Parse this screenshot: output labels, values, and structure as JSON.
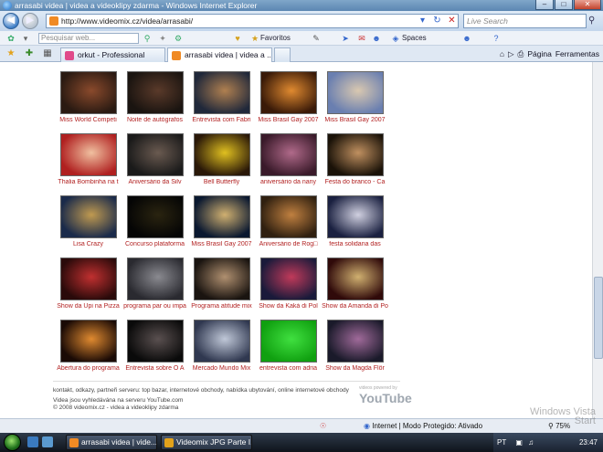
{
  "window": {
    "title": "arrasabi videa | videa a videoklipy zdarma - Windows Internet Explorer"
  },
  "address": {
    "url": "http://www.videomix.cz/videa/arrasabi/",
    "search_placeholder": "Live Search"
  },
  "toolbar": {
    "search_placeholder": "Pesquisar web...",
    "favorites": "Favoritos",
    "spaces": "Spaces"
  },
  "tabs": [
    {
      "label": "orkut - Professional",
      "active": false
    },
    {
      "label": "arrasabi videa | videa a ...",
      "active": true
    }
  ],
  "commandbar": {
    "page": "Página",
    "tools": "Ferramentas"
  },
  "videos": [
    [
      {
        "caption": "Miss World Competi",
        "colors": [
          "#2a1a12",
          "#8a4a2c"
        ]
      },
      {
        "caption": "Noite de autógrafos",
        "colors": [
          "#1a1410",
          "#5a3a2a"
        ]
      },
      {
        "caption": "Entrevista com Fabri",
        "colors": [
          "#20283a",
          "#b08050"
        ]
      },
      {
        "caption": "Miss Brasil Gay 2007",
        "colors": [
          "#3a1a08",
          "#e08a30"
        ]
      },
      {
        "caption": "Miss Brasil Gay 2007",
        "colors": [
          "#6a7fb0",
          "#d9c8b0"
        ]
      }
    ],
    [
      {
        "caption": "Thalia Bombinha na t",
        "colors": [
          "#b02020",
          "#f0c0a0"
        ]
      },
      {
        "caption": "Aniversário da Silv",
        "colors": [
          "#1a1a1a",
          "#6a5a50"
        ]
      },
      {
        "caption": "Bell Butterfly",
        "colors": [
          "#2a1808",
          "#e0c020"
        ]
      },
      {
        "caption": "aniversário da nany",
        "colors": [
          "#3a1a2a",
          "#b06a8a"
        ]
      },
      {
        "caption": "Festa do branco - Ca",
        "colors": [
          "#1a1208",
          "#c09060"
        ]
      }
    ],
    [
      {
        "caption": "Lisa Crazy",
        "colors": [
          "#1a2a4a",
          "#c09a50"
        ]
      },
      {
        "caption": "Concurso plataforma",
        "colors": [
          "#050505",
          "#2a2410"
        ]
      },
      {
        "caption": "Miss Brasil Gay 2007",
        "colors": [
          "#0a1830",
          "#d0b070"
        ]
      },
      {
        "caption": "Aniversário de Rog□",
        "colors": [
          "#302010",
          "#c08040"
        ]
      },
      {
        "caption": "festa solidana das",
        "colors": [
          "#1a2040",
          "#d0d0e0"
        ]
      }
    ],
    [
      {
        "caption": "Show da Upi na Pizza",
        "colors": [
          "#2a0a0a",
          "#c03030"
        ]
      },
      {
        "caption": "programa par ou impa",
        "colors": [
          "#2a2a30",
          "#8a8a90"
        ]
      },
      {
        "caption": "Programa atitude mix",
        "colors": [
          "#1a1410",
          "#b09070"
        ]
      },
      {
        "caption": "Show da Kaká di Pol",
        "colors": [
          "#1a1a3a",
          "#c03a5a"
        ]
      },
      {
        "caption": "Show da Amanda di Po",
        "colors": [
          "#300a0a",
          "#d0b070"
        ]
      }
    ],
    [
      {
        "caption": "Abertura do programa",
        "colors": [
          "#1a0a05",
          "#e08a30"
        ]
      },
      {
        "caption": "Entrevista sobre O A",
        "colors": [
          "#0a0a0a",
          "#5a5050"
        ]
      },
      {
        "caption": "Mercado Mundo Mix",
        "colors": [
          "#303850",
          "#c0c8d8"
        ]
      },
      {
        "caption": "entrevista com adria",
        "colors": [
          "#10a010",
          "#40e040"
        ]
      },
      {
        "caption": "Show da Magda Flôr",
        "colors": [
          "#1a1a2a",
          "#a06a9a"
        ]
      }
    ]
  ],
  "footer": {
    "line1": "kontakt, odkazy, partneři serveru: top bazar, internetové obchody, nabídka ubytování, online internetové obchody",
    "line2": "Videa jsou vyhledávána na serveru YouTube.com",
    "line3": "© 2008 videomix.cz - videa a videoklipy zdarma",
    "powered": "videos powered by",
    "youtube": "YouTube"
  },
  "status": {
    "zone": "Internet | Modo Protegido: Ativado",
    "zoom": "75%"
  },
  "watermark": {
    "line1": "Windows Vista",
    "line2": "Start"
  },
  "taskbar": {
    "items": [
      {
        "label": "arrasabi videa | vide...",
        "color": "#f08a24"
      },
      {
        "label": "Videomix JPG Parte I...",
        "color": "#e2a21b"
      }
    ],
    "lang": "PT",
    "clock": "23:47"
  },
  "colors": {
    "caption": "#b22222",
    "accent": "#3f7fc7"
  }
}
